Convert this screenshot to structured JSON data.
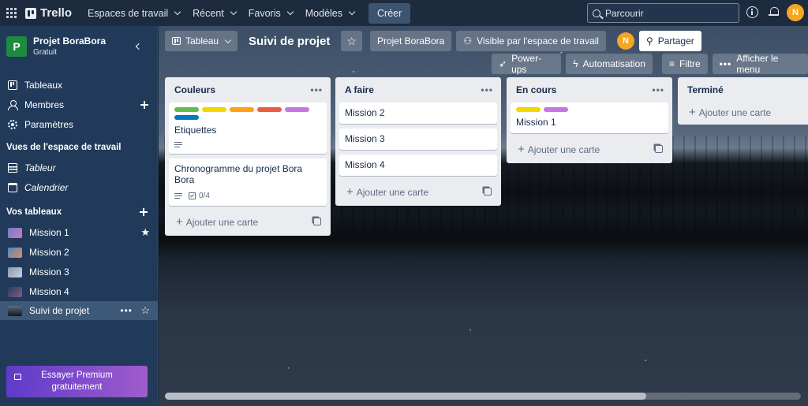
{
  "topbar": {
    "brand": "Trello",
    "nav": [
      "Espaces de travail",
      "Récent",
      "Favoris",
      "Modèles"
    ],
    "create_label": "Créer",
    "search_placeholder": "Parcourir",
    "avatar_initial": "N"
  },
  "sidebar": {
    "workspace_initial": "P",
    "workspace_name": "Projet BoraBora",
    "workspace_plan": "Gratuit",
    "menu": [
      "Tableaux",
      "Membres",
      "Paramètres"
    ],
    "views_title": "Vues de l'espace de travail",
    "views": [
      "Tableur",
      "Calendrier"
    ],
    "boards_title": "Vos tableaux",
    "boards": [
      {
        "name": "Mission 1",
        "starred": true
      },
      {
        "name": "Mission 2",
        "starred": false
      },
      {
        "name": "Mission 3",
        "starred": false
      },
      {
        "name": "Mission 4",
        "starred": false
      },
      {
        "name": "Suivi de projet",
        "starred": false,
        "active": true
      }
    ],
    "premium_label": "Essayer Premium gratuitement"
  },
  "board": {
    "view_label": "Tableau",
    "title": "Suivi de projet",
    "workspace_btn": "Projet BoraBora",
    "visibility_btn": "Visible par l'espace de travail",
    "member_initial": "N",
    "share_btn": "Partager",
    "powerups_btn": "Power-ups",
    "automation_btn": "Automatisation",
    "filter_btn": "Filtre",
    "menu_btn": "Afficher le menu",
    "add_card_label": "Ajouter une carte"
  },
  "lists": [
    {
      "title": "Couleurs",
      "cards": [
        {
          "title": "Etiquettes",
          "labels": [
            "#61bd4f",
            "#f2d600",
            "#ff9f1a",
            "#eb5a46",
            "#c377e0",
            "#0079bf"
          ],
          "description": true
        },
        {
          "title": "Chronogramme du projet Bora Bora",
          "description": true,
          "checklist": "0/4"
        }
      ]
    },
    {
      "title": "A faire",
      "cards": [
        {
          "title": "Mission 2"
        },
        {
          "title": "Mission 3"
        },
        {
          "title": "Mission 4"
        }
      ]
    },
    {
      "title": "En cours",
      "cards": [
        {
          "title": "Mission 1",
          "labels": [
            "#f2d600",
            "#c377e0"
          ]
        }
      ]
    },
    {
      "title": "Terminé",
      "cards": []
    }
  ],
  "colors": {
    "topbar": "#1d2b3f",
    "sidebar": "#213a5a",
    "workspace_logo": "#1f8a3f",
    "avatar": "#f5a623",
    "premium_start": "#5e3bc9",
    "premium_end": "#a05bcc"
  }
}
